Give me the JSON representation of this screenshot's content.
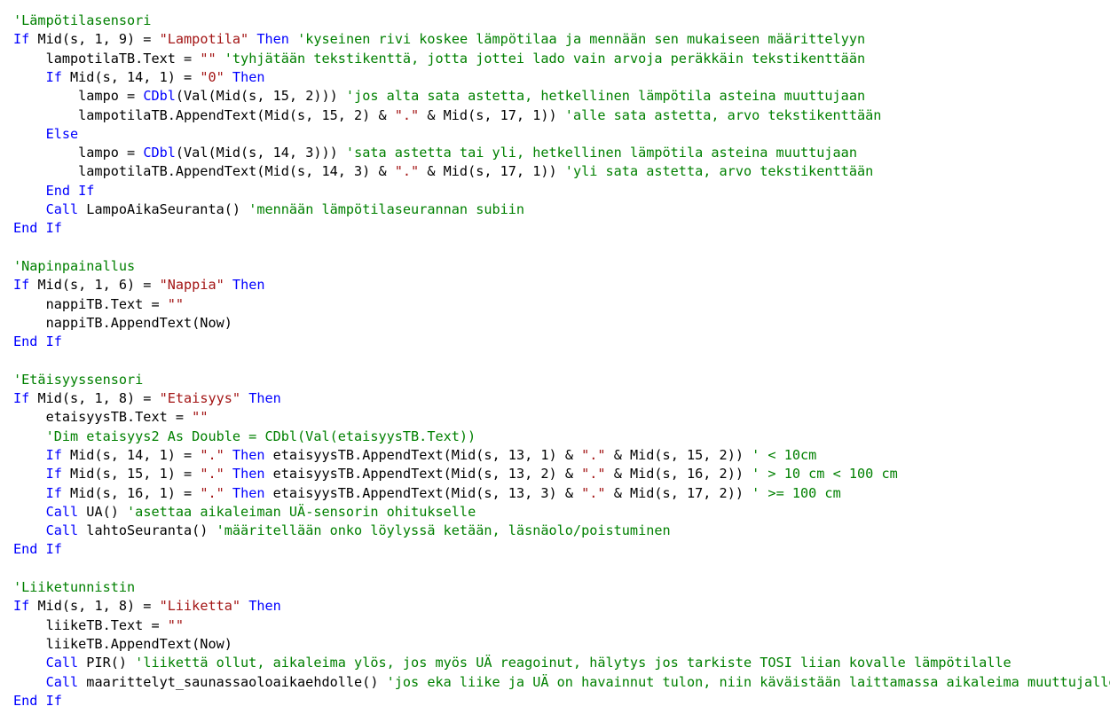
{
  "colors": {
    "background": "#ffffff",
    "keyword": "#0000ff",
    "string": "#a31515",
    "comment": "#008000",
    "text": "#000000"
  },
  "code": {
    "lines": [
      [
        [
          "cm",
          "'Lämpötilasensori"
        ]
      ],
      [
        [
          "kw",
          "If"
        ],
        [
          "id",
          " Mid(s, 1, 9) = "
        ],
        [
          "str",
          "\"Lampotila\""
        ],
        [
          "id",
          " "
        ],
        [
          "kw",
          "Then"
        ],
        [
          "id",
          " "
        ],
        [
          "cm",
          "'kyseinen rivi koskee lämpötilaa ja mennään sen mukaiseen määrittelyyn"
        ]
      ],
      [
        [
          "id",
          "    lampotilaTB.Text = "
        ],
        [
          "str",
          "\"\""
        ],
        [
          "id",
          " "
        ],
        [
          "cm",
          "'tyhjätään tekstikenttä, jotta jottei lado vain arvoja peräkkäin tekstikenttään"
        ]
      ],
      [
        [
          "id",
          "    "
        ],
        [
          "kw",
          "If"
        ],
        [
          "id",
          " Mid(s, 14, 1) = "
        ],
        [
          "str",
          "\"0\""
        ],
        [
          "id",
          " "
        ],
        [
          "kw",
          "Then"
        ]
      ],
      [
        [
          "id",
          "        lampo = "
        ],
        [
          "kw",
          "CDbl"
        ],
        [
          "id",
          "(Val(Mid(s, 15, 2))) "
        ],
        [
          "cm",
          "'jos alta sata astetta, hetkellinen lämpötila asteina muuttujaan"
        ]
      ],
      [
        [
          "id",
          "        lampotilaTB.AppendText(Mid(s, 15, 2) & "
        ],
        [
          "str",
          "\".\""
        ],
        [
          "id",
          " & Mid(s, 17, 1)) "
        ],
        [
          "cm",
          "'alle sata astetta, arvo tekstikenttään"
        ]
      ],
      [
        [
          "id",
          "    "
        ],
        [
          "kw",
          "Else"
        ]
      ],
      [
        [
          "id",
          "        lampo = "
        ],
        [
          "kw",
          "CDbl"
        ],
        [
          "id",
          "(Val(Mid(s, 14, 3))) "
        ],
        [
          "cm",
          "'sata astetta tai yli, hetkellinen lämpötila asteina muuttujaan"
        ]
      ],
      [
        [
          "id",
          "        lampotilaTB.AppendText(Mid(s, 14, 3) & "
        ],
        [
          "str",
          "\".\""
        ],
        [
          "id",
          " & Mid(s, 17, 1)) "
        ],
        [
          "cm",
          "'yli sata astetta, arvo tekstikenttään"
        ]
      ],
      [
        [
          "id",
          "    "
        ],
        [
          "kw",
          "End If"
        ]
      ],
      [
        [
          "id",
          "    "
        ],
        [
          "kw",
          "Call"
        ],
        [
          "id",
          " LampoAikaSeuranta() "
        ],
        [
          "cm",
          "'mennään lämpötilaseurannan subiin"
        ]
      ],
      [
        [
          "kw",
          "End If"
        ]
      ],
      [],
      [
        [
          "cm",
          "'Napinpainallus"
        ]
      ],
      [
        [
          "kw",
          "If"
        ],
        [
          "id",
          " Mid(s, 1, 6) = "
        ],
        [
          "str",
          "\"Nappia\""
        ],
        [
          "id",
          " "
        ],
        [
          "kw",
          "Then"
        ]
      ],
      [
        [
          "id",
          "    nappiTB.Text = "
        ],
        [
          "str",
          "\"\""
        ]
      ],
      [
        [
          "id",
          "    nappiTB.AppendText(Now)"
        ]
      ],
      [
        [
          "kw",
          "End If"
        ]
      ],
      [],
      [
        [
          "cm",
          "'Etäisyyssensori"
        ]
      ],
      [
        [
          "kw",
          "If"
        ],
        [
          "id",
          " Mid(s, 1, 8) = "
        ],
        [
          "str",
          "\"Etaisyys\""
        ],
        [
          "id",
          " "
        ],
        [
          "kw",
          "Then"
        ]
      ],
      [
        [
          "id",
          "    etaisyysTB.Text = "
        ],
        [
          "str",
          "\"\""
        ]
      ],
      [
        [
          "id",
          "    "
        ],
        [
          "cm",
          "'Dim etaisyys2 As Double = CDbl(Val(etaisyysTB.Text))"
        ]
      ],
      [
        [
          "id",
          "    "
        ],
        [
          "kw",
          "If"
        ],
        [
          "id",
          " Mid(s, 14, 1) = "
        ],
        [
          "str",
          "\".\""
        ],
        [
          "id",
          " "
        ],
        [
          "kw",
          "Then"
        ],
        [
          "id",
          " etaisyysTB.AppendText(Mid(s, 13, 1) & "
        ],
        [
          "str",
          "\".\""
        ],
        [
          "id",
          " & Mid(s, 15, 2)) "
        ],
        [
          "cm",
          "' < 10cm"
        ]
      ],
      [
        [
          "id",
          "    "
        ],
        [
          "kw",
          "If"
        ],
        [
          "id",
          " Mid(s, 15, 1) = "
        ],
        [
          "str",
          "\".\""
        ],
        [
          "id",
          " "
        ],
        [
          "kw",
          "Then"
        ],
        [
          "id",
          " etaisyysTB.AppendText(Mid(s, 13, 2) & "
        ],
        [
          "str",
          "\".\""
        ],
        [
          "id",
          " & Mid(s, 16, 2)) "
        ],
        [
          "cm",
          "' > 10 cm < 100 cm"
        ]
      ],
      [
        [
          "id",
          "    "
        ],
        [
          "kw",
          "If"
        ],
        [
          "id",
          " Mid(s, 16, 1) = "
        ],
        [
          "str",
          "\".\""
        ],
        [
          "id",
          " "
        ],
        [
          "kw",
          "Then"
        ],
        [
          "id",
          " etaisyysTB.AppendText(Mid(s, 13, 3) & "
        ],
        [
          "str",
          "\".\""
        ],
        [
          "id",
          " & Mid(s, 17, 2)) "
        ],
        [
          "cm",
          "' >= 100 cm"
        ]
      ],
      [
        [
          "id",
          "    "
        ],
        [
          "kw",
          "Call"
        ],
        [
          "id",
          " UA() "
        ],
        [
          "cm",
          "'asettaa aikaleiman UÄ-sensorin ohitukselle"
        ]
      ],
      [
        [
          "id",
          "    "
        ],
        [
          "kw",
          "Call"
        ],
        [
          "id",
          " lahtoSeuranta() "
        ],
        [
          "cm",
          "'määritellään onko löylyssä ketään, läsnäolo/poistuminen"
        ]
      ],
      [
        [
          "kw",
          "End If"
        ]
      ],
      [],
      [
        [
          "cm",
          "'Liiketunnistin"
        ]
      ],
      [
        [
          "kw",
          "If"
        ],
        [
          "id",
          " Mid(s, 1, 8) = "
        ],
        [
          "str",
          "\"Liiketta\""
        ],
        [
          "id",
          " "
        ],
        [
          "kw",
          "Then"
        ]
      ],
      [
        [
          "id",
          "    liikeTB.Text = "
        ],
        [
          "str",
          "\"\""
        ]
      ],
      [
        [
          "id",
          "    liikeTB.AppendText(Now)"
        ]
      ],
      [
        [
          "id",
          "    "
        ],
        [
          "kw",
          "Call"
        ],
        [
          "id",
          " PIR() "
        ],
        [
          "cm",
          "'liikettä ollut, aikaleima ylös, jos myös UÄ reagoinut, hälytys jos tarkiste TOSI liian kovalle lämpötilalle"
        ]
      ],
      [
        [
          "id",
          "    "
        ],
        [
          "kw",
          "Call"
        ],
        [
          "id",
          " maarittelyt_saunassaoloaikaehdolle() "
        ],
        [
          "cm",
          "'jos eka liike ja UÄ on havainnut tulon, niin käväistään laittamassa aikaleima muuttujalle"
        ]
      ],
      [
        [
          "kw",
          "End If"
        ]
      ]
    ]
  }
}
